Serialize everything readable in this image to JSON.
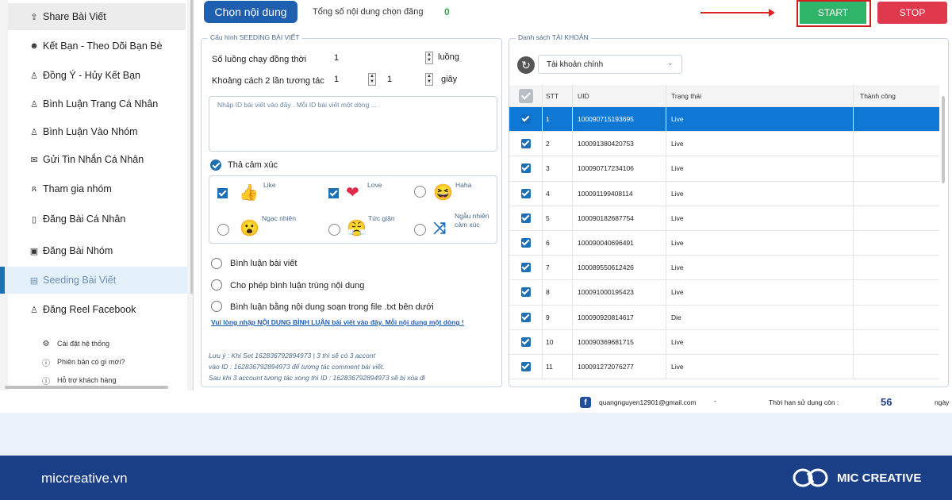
{
  "sidebar": {
    "items": [
      {
        "label": "Share Bài Viết",
        "icon": "share-icon"
      },
      {
        "label": "Kết Bạn - Theo Dõi Bạn Bè",
        "icon": "users-icon"
      },
      {
        "label": "Đồng Ý - Hủy Kết Bạn",
        "icon": "user-check-icon"
      },
      {
        "label": "Bình Luận Trang Cá Nhân",
        "icon": "user-comment-icon"
      },
      {
        "label": "Bình Luận Vào Nhóm",
        "icon": "group-comment-icon"
      },
      {
        "label": "Gửi Tin Nhắn Cá Nhân",
        "icon": "message-icon"
      },
      {
        "label": "Tham gia nhóm",
        "icon": "join-group-icon"
      },
      {
        "label": "Đăng Bài Cá Nhân",
        "icon": "book-icon"
      },
      {
        "label": "Đăng Bài Nhóm",
        "icon": "post-group-icon"
      },
      {
        "label": "Seeding Bài Viết",
        "icon": "seeding-icon"
      },
      {
        "label": "Đăng Reel Facebook",
        "icon": "reel-icon"
      }
    ],
    "sub_items": [
      {
        "label": "Cài đặt hệ thống",
        "icon": "gear-icon"
      },
      {
        "label": "Phiên bản có gì mới?",
        "icon": "info-icon"
      },
      {
        "label": "Hỗ trợ khách hàng",
        "icon": "help-icon"
      }
    ]
  },
  "toolbar": {
    "choose_label": "Chọn nội dung",
    "total_label": "Tổng số nội dung chọn đăng",
    "total_count": "0",
    "start_label": "START",
    "stop_label": "STOP"
  },
  "seeding": {
    "legend": "Cấu hình SEEDING BÀI VIẾT",
    "threads_label": "Số luồng chạy đồng thời",
    "threads_value": "1",
    "threads_unit": "luồng",
    "interval_label": "Khoảng cách 2 lần tương tác",
    "interval_min": "1",
    "interval_max": "1",
    "interval_unit": "giây",
    "id_placeholder": "Nhập ID bài viết vào đây . Mỗi ID bài viết một dòng ...",
    "react_label": "Thả cảm xúc",
    "reactions": [
      {
        "label": "Like",
        "icon": "thumbs-up-icon",
        "selected": true
      },
      {
        "label": "Love",
        "icon": "heart-icon",
        "selected": true
      },
      {
        "label": "Haha",
        "icon": "haha-icon",
        "selected": false
      },
      {
        "label": "Ngạc nhiên",
        "icon": "wow-icon",
        "selected": false
      },
      {
        "label": "Tức giận",
        "icon": "angry-icon",
        "selected": false
      },
      {
        "label": "Ngẫu nhiên cảm xúc",
        "label_line1": "Ngẫu nhiên",
        "label_line2": "cảm xúc",
        "icon": "shuffle-icon",
        "selected": false
      }
    ],
    "comment_label": "Bình luận bài viết",
    "allow_dup_label": "Cho phép bình luận trùng nội dung",
    "file_comment_label": "Bình luận bằng nội dung soạn trong file .txt bên dưới",
    "comment_link": "Vui lòng nhập NỘI DUNG BÌNH LUẬN bài viết vào đây. Mỗi nội dung một dòng !",
    "notes": [
      "Lưu ý : Khi Set 162836792894973 | 3 thì sẽ có 3 accont",
      "vào ID : 162836792894973 để tương tác comment bài viết.",
      "Sau khi 3 account tương tác xong thì ID : 162836792894973 sẽ bị xóa đi"
    ]
  },
  "accounts": {
    "legend": "Danh sách TÀI KHOẢN",
    "select_value": "Tài khoản chính",
    "columns": [
      "STT",
      "UID",
      "Trạng thái",
      "Thành công"
    ],
    "rows": [
      {
        "stt": "1",
        "uid": "100090715193695",
        "status": "Live",
        "success": ""
      },
      {
        "stt": "2",
        "uid": "100091380420753",
        "status": "Live",
        "success": ""
      },
      {
        "stt": "3",
        "uid": "100090717234106",
        "status": "Live",
        "success": ""
      },
      {
        "stt": "4",
        "uid": "100091199408114",
        "status": "Live",
        "success": ""
      },
      {
        "stt": "5",
        "uid": "100090182687754",
        "status": "Live",
        "success": ""
      },
      {
        "stt": "6",
        "uid": "100090040696491",
        "status": "Live",
        "success": ""
      },
      {
        "stt": "7",
        "uid": "100089550612426",
        "status": "Live",
        "success": ""
      },
      {
        "stt": "8",
        "uid": "100091000195423",
        "status": "Live",
        "success": ""
      },
      {
        "stt": "9",
        "uid": "100090920814617",
        "status": "Die",
        "success": ""
      },
      {
        "stt": "10",
        "uid": "100090369681715",
        "status": "Live",
        "success": ""
      },
      {
        "stt": "11",
        "uid": "100091272076277",
        "status": "Live",
        "success": ""
      }
    ]
  },
  "status": {
    "email": "quangnguyen12901@gmail.com",
    "dash": "-",
    "days_label": "Thời hạn sử dụng còn :",
    "days_value": "56",
    "days_unit": "ngày"
  },
  "footer": {
    "url": "miccreative.vn",
    "brand": "MIC CREATIVE"
  },
  "colors": {
    "primary": "#1f5fb0",
    "start": "#2fb56a",
    "stop": "#e0394d",
    "footer": "#1b3f86",
    "selected_row": "#0f78d4"
  }
}
